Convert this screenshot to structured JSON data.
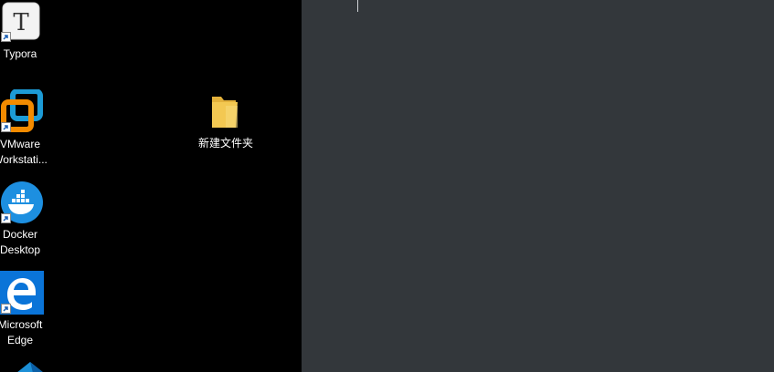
{
  "desktop": {
    "icons": [
      {
        "label": "Typora",
        "icon": "typora-icon"
      },
      {
        "label_line1": "VMware",
        "label_line2": "Workstati...",
        "icon": "vmware-icon"
      },
      {
        "label_line1": "Docker",
        "label_line2": "Desktop",
        "icon": "docker-icon"
      },
      {
        "label_line1": "Microsoft",
        "label_line2": "Edge",
        "icon": "edge-icon"
      },
      {
        "label": "新建文件夹",
        "icon": "folder-icon"
      }
    ],
    "typora_glyph": "T"
  },
  "colors": {
    "desktop_bg": "#000000",
    "editor_bg": "#33373b",
    "edge_blue": "#0a74d8",
    "docker_blue": "#1d8fe0",
    "vmware_orange": "#f38b00",
    "vmware_blue": "#1c9bd6",
    "folder_yellow": "#f3c852"
  }
}
